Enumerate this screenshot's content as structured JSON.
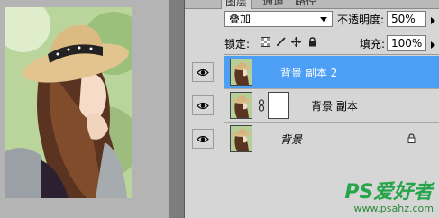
{
  "panel": {
    "tabs": [
      "图层",
      "通道",
      "路径"
    ],
    "blend_mode": "叠加",
    "opacity_label": "不透明度:",
    "opacity_value": "50%",
    "lock_label": "锁定:",
    "fill_label": "填充:",
    "fill_value": "100%"
  },
  "layers": [
    {
      "name": "背景 副本 2",
      "selected": true,
      "has_mask": false,
      "locked": false
    },
    {
      "name": "背景 副本",
      "selected": false,
      "has_mask": true,
      "locked": false
    },
    {
      "name": "背景",
      "selected": false,
      "has_mask": false,
      "locked": true
    }
  ],
  "watermark": {
    "brand": "PS爱好者",
    "url": "www.psahz.com"
  },
  "colors": {
    "selected_layer": "#4d9ff5",
    "panel_bg": "#d6d6d6",
    "watermark": "#26a54a"
  }
}
